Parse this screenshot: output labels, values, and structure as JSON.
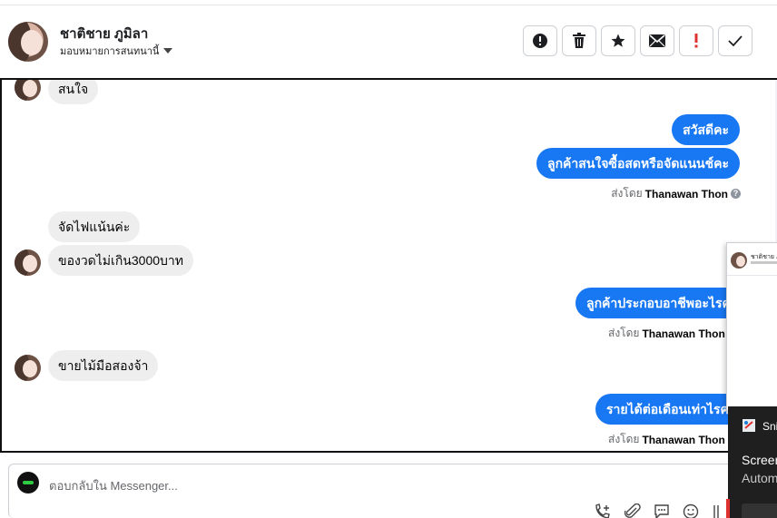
{
  "header": {
    "contact_name": "ชาติชาย ภูมิลา",
    "assign_label": "มอบหมายการสนทนานี้",
    "actions": [
      {
        "name": "report-button",
        "icon": "exclamation-circle-icon"
      },
      {
        "name": "delete-button",
        "icon": "trash-icon"
      },
      {
        "name": "star-button",
        "icon": "star-icon"
      },
      {
        "name": "mark-unread-button",
        "icon": "envelope-icon"
      },
      {
        "name": "flag-button",
        "icon": "red-exclamation-icon",
        "color": "#e03131"
      },
      {
        "name": "done-button",
        "icon": "check-icon"
      }
    ]
  },
  "messages": [
    {
      "direction": "in",
      "text": "สนใจ",
      "avatar": true
    },
    {
      "direction": "out",
      "text": "สวัสดีคะ"
    },
    {
      "direction": "out",
      "text": "ลูกค้าสนใจซื้อสดหรือจัดแนนช์คะ"
    },
    {
      "direction": "in",
      "text": "จัดไฟแน้นค่ะ",
      "avatar": false
    },
    {
      "direction": "in",
      "text": "ของวดไม่เกิน3000บาท",
      "avatar": true
    },
    {
      "direction": "out",
      "text": "ลูกค้าประกอบอาชีพอะไรคะ"
    },
    {
      "direction": "in",
      "text": "ขายไม้มือสองจ้า",
      "avatar": true
    },
    {
      "direction": "out",
      "text": "รายได้ต่อเดือนเท่าไรคะ"
    }
  ],
  "sent_by": {
    "prefix": "ส่งโดย",
    "agent": "Thanawan Thon",
    "help": "?"
  },
  "composer": {
    "placeholder": "ตอบกลับใน Messenger...",
    "tools": [
      "call-add-icon",
      "paperclip-icon",
      "speech-bubble-icon",
      "emoji-icon",
      "more-icon"
    ]
  },
  "mini_window": {
    "name": "ชาติชาย ภ"
  },
  "snip_notification": {
    "title": "Sni",
    "line1": "Screen",
    "line2": "Autom"
  },
  "colors": {
    "outgoing_bubble": "#1877f2",
    "incoming_bubble": "#eeeeee",
    "flag_red": "#e03131"
  }
}
